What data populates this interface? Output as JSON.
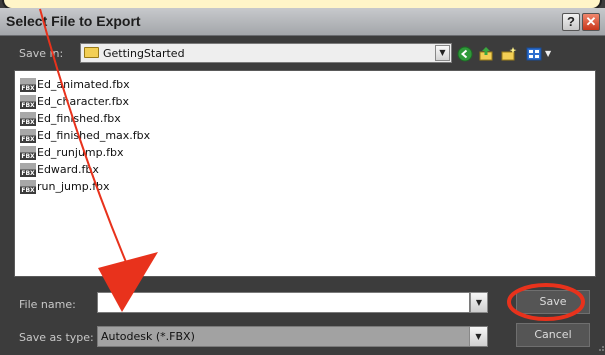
{
  "window": {
    "title": "Select File to Export",
    "help_label": "?",
    "close_label": "✕"
  },
  "toolbar": {
    "save_in_label": "Save in:",
    "location": "GettingStarted",
    "icons": [
      "back-icon",
      "up-folder-icon",
      "new-folder-icon",
      "views-menu-icon"
    ]
  },
  "files": [
    {
      "name": "Ed_animated.fbx",
      "icon": "fbx-file-icon"
    },
    {
      "name": "Ed_character.fbx",
      "icon": "fbx-file-icon"
    },
    {
      "name": "Ed_finished.fbx",
      "icon": "fbx-file-icon"
    },
    {
      "name": "Ed_finished_max.fbx",
      "icon": "fbx-file-icon"
    },
    {
      "name": "Ed_runjump.fbx",
      "icon": "fbx-file-icon"
    },
    {
      "name": "Edward.fbx",
      "icon": "fbx-file-icon"
    },
    {
      "name": "run_jump.fbx",
      "icon": "fbx-file-icon"
    }
  ],
  "file_icon_text": "FBX",
  "bottom": {
    "file_name_label": "File name:",
    "file_name_value": "",
    "save_as_type_label": "Save as type:",
    "save_as_type_value": "Autodesk (*.FBX)",
    "save_label": "Save",
    "cancel_label": "Cancel"
  },
  "colors": {
    "dialog_bg": "#3c3c3c",
    "annotation_red": "#e8321c",
    "callout_bg": "#fff5c8"
  }
}
